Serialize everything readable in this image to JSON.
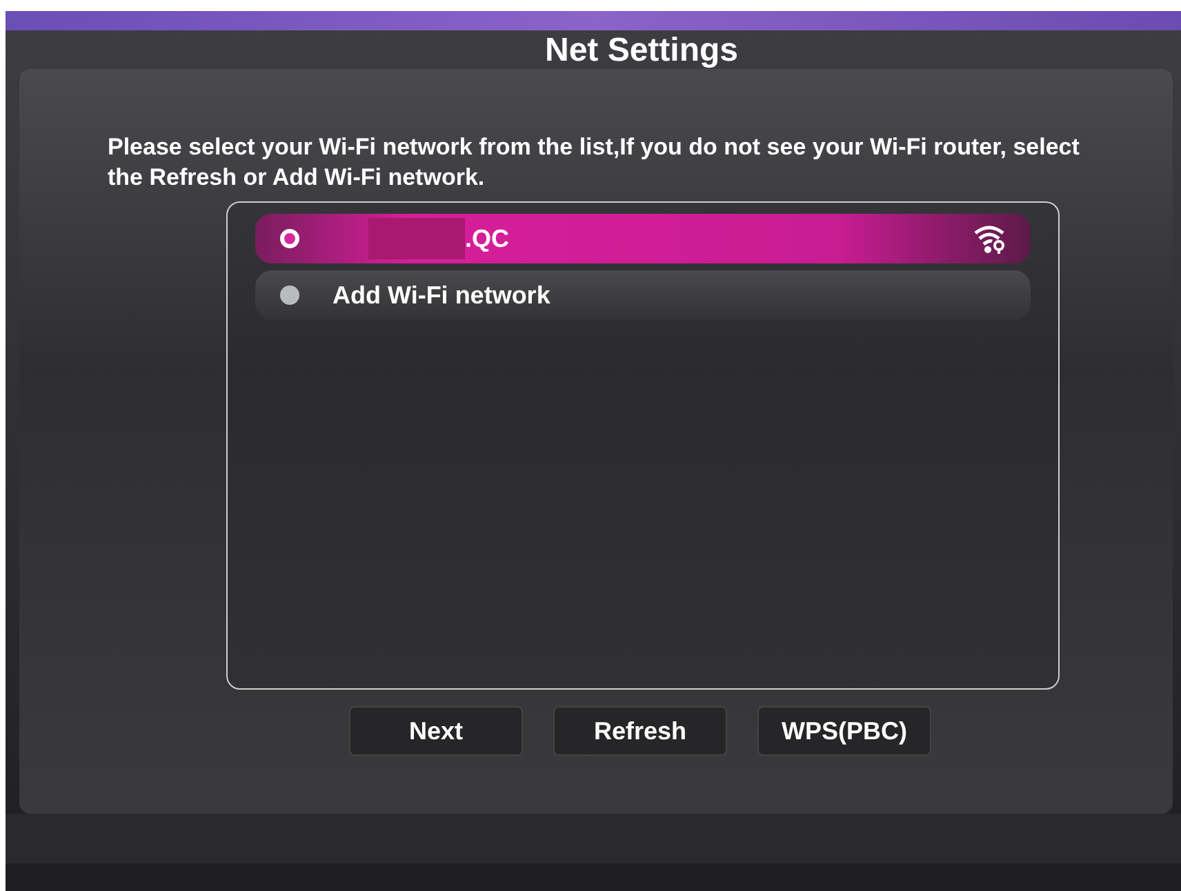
{
  "screen": {
    "title": "Net Settings"
  },
  "instruction": "Please select your Wi-Fi network from the list,If you do not see your Wi-Fi router, select the Refresh or Add Wi-Fi network.",
  "networks": [
    {
      "kind": "network",
      "name": ".QC",
      "selected": true
    },
    {
      "kind": "add",
      "name": "Add Wi-Fi network",
      "selected": false
    }
  ],
  "buttons": [
    "Next",
    "Refresh",
    "WPS(PBC)"
  ]
}
